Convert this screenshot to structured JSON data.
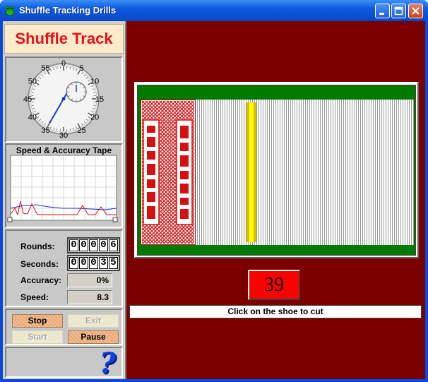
{
  "window": {
    "title": "Shuffle Tracking Drills",
    "controls": {
      "minimize": "minimize-icon",
      "maximize": "maximize-icon",
      "close": "close-icon"
    }
  },
  "app": {
    "title": "Shuffle Track"
  },
  "stopwatch": {
    "outer_labels": [
      "0",
      "5",
      "10",
      "15",
      "20",
      "25",
      "30",
      "35",
      "40",
      "45",
      "50",
      "55"
    ],
    "seconds_hand_value": 35,
    "subdial_minutes_value": 0
  },
  "tape": {
    "title": "Speed & Accuracy Tape"
  },
  "stats": {
    "rounds_label": "Rounds:",
    "rounds_digits": [
      "0",
      "0",
      "0",
      "0",
      "6"
    ],
    "seconds_label": "Seconds:",
    "seconds_digits": [
      "0",
      "0",
      "0",
      "3",
      "5"
    ],
    "accuracy_label": "Accuracy:",
    "accuracy_value": "0%",
    "speed_label": "Speed:",
    "speed_value": "8.3"
  },
  "buttons": {
    "stop": "Stop",
    "exit": "Exit",
    "start": "Start",
    "pause": "Pause"
  },
  "help": {
    "icon": "help-question-icon",
    "glyph": "?"
  },
  "shoe": {
    "card_count": "39"
  },
  "status": {
    "message": "Click on the shoe to cut"
  },
  "colors": {
    "background_right": "#7b0000",
    "felt": "#007a00",
    "count_box": "#ff0000",
    "cut_card": "#ffff00",
    "title_red": "#e8101c"
  }
}
